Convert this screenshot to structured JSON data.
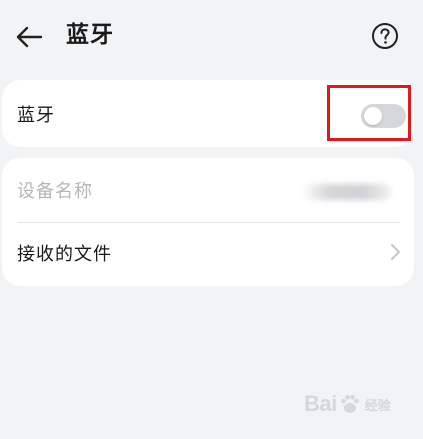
{
  "header": {
    "title": "蓝牙",
    "back_icon": "arrow-left-icon",
    "help_icon": "question-circle-icon"
  },
  "bluetooth": {
    "label": "蓝牙",
    "enabled": false,
    "highlight_color": "#e0191e"
  },
  "info": {
    "device_name_label": "设备名称",
    "received_files_label": "接收的文件",
    "chevron_icon": "chevron-right-icon"
  },
  "watermark": {
    "brand_left": "Bai",
    "brand_right": "",
    "suffix": "经验"
  }
}
